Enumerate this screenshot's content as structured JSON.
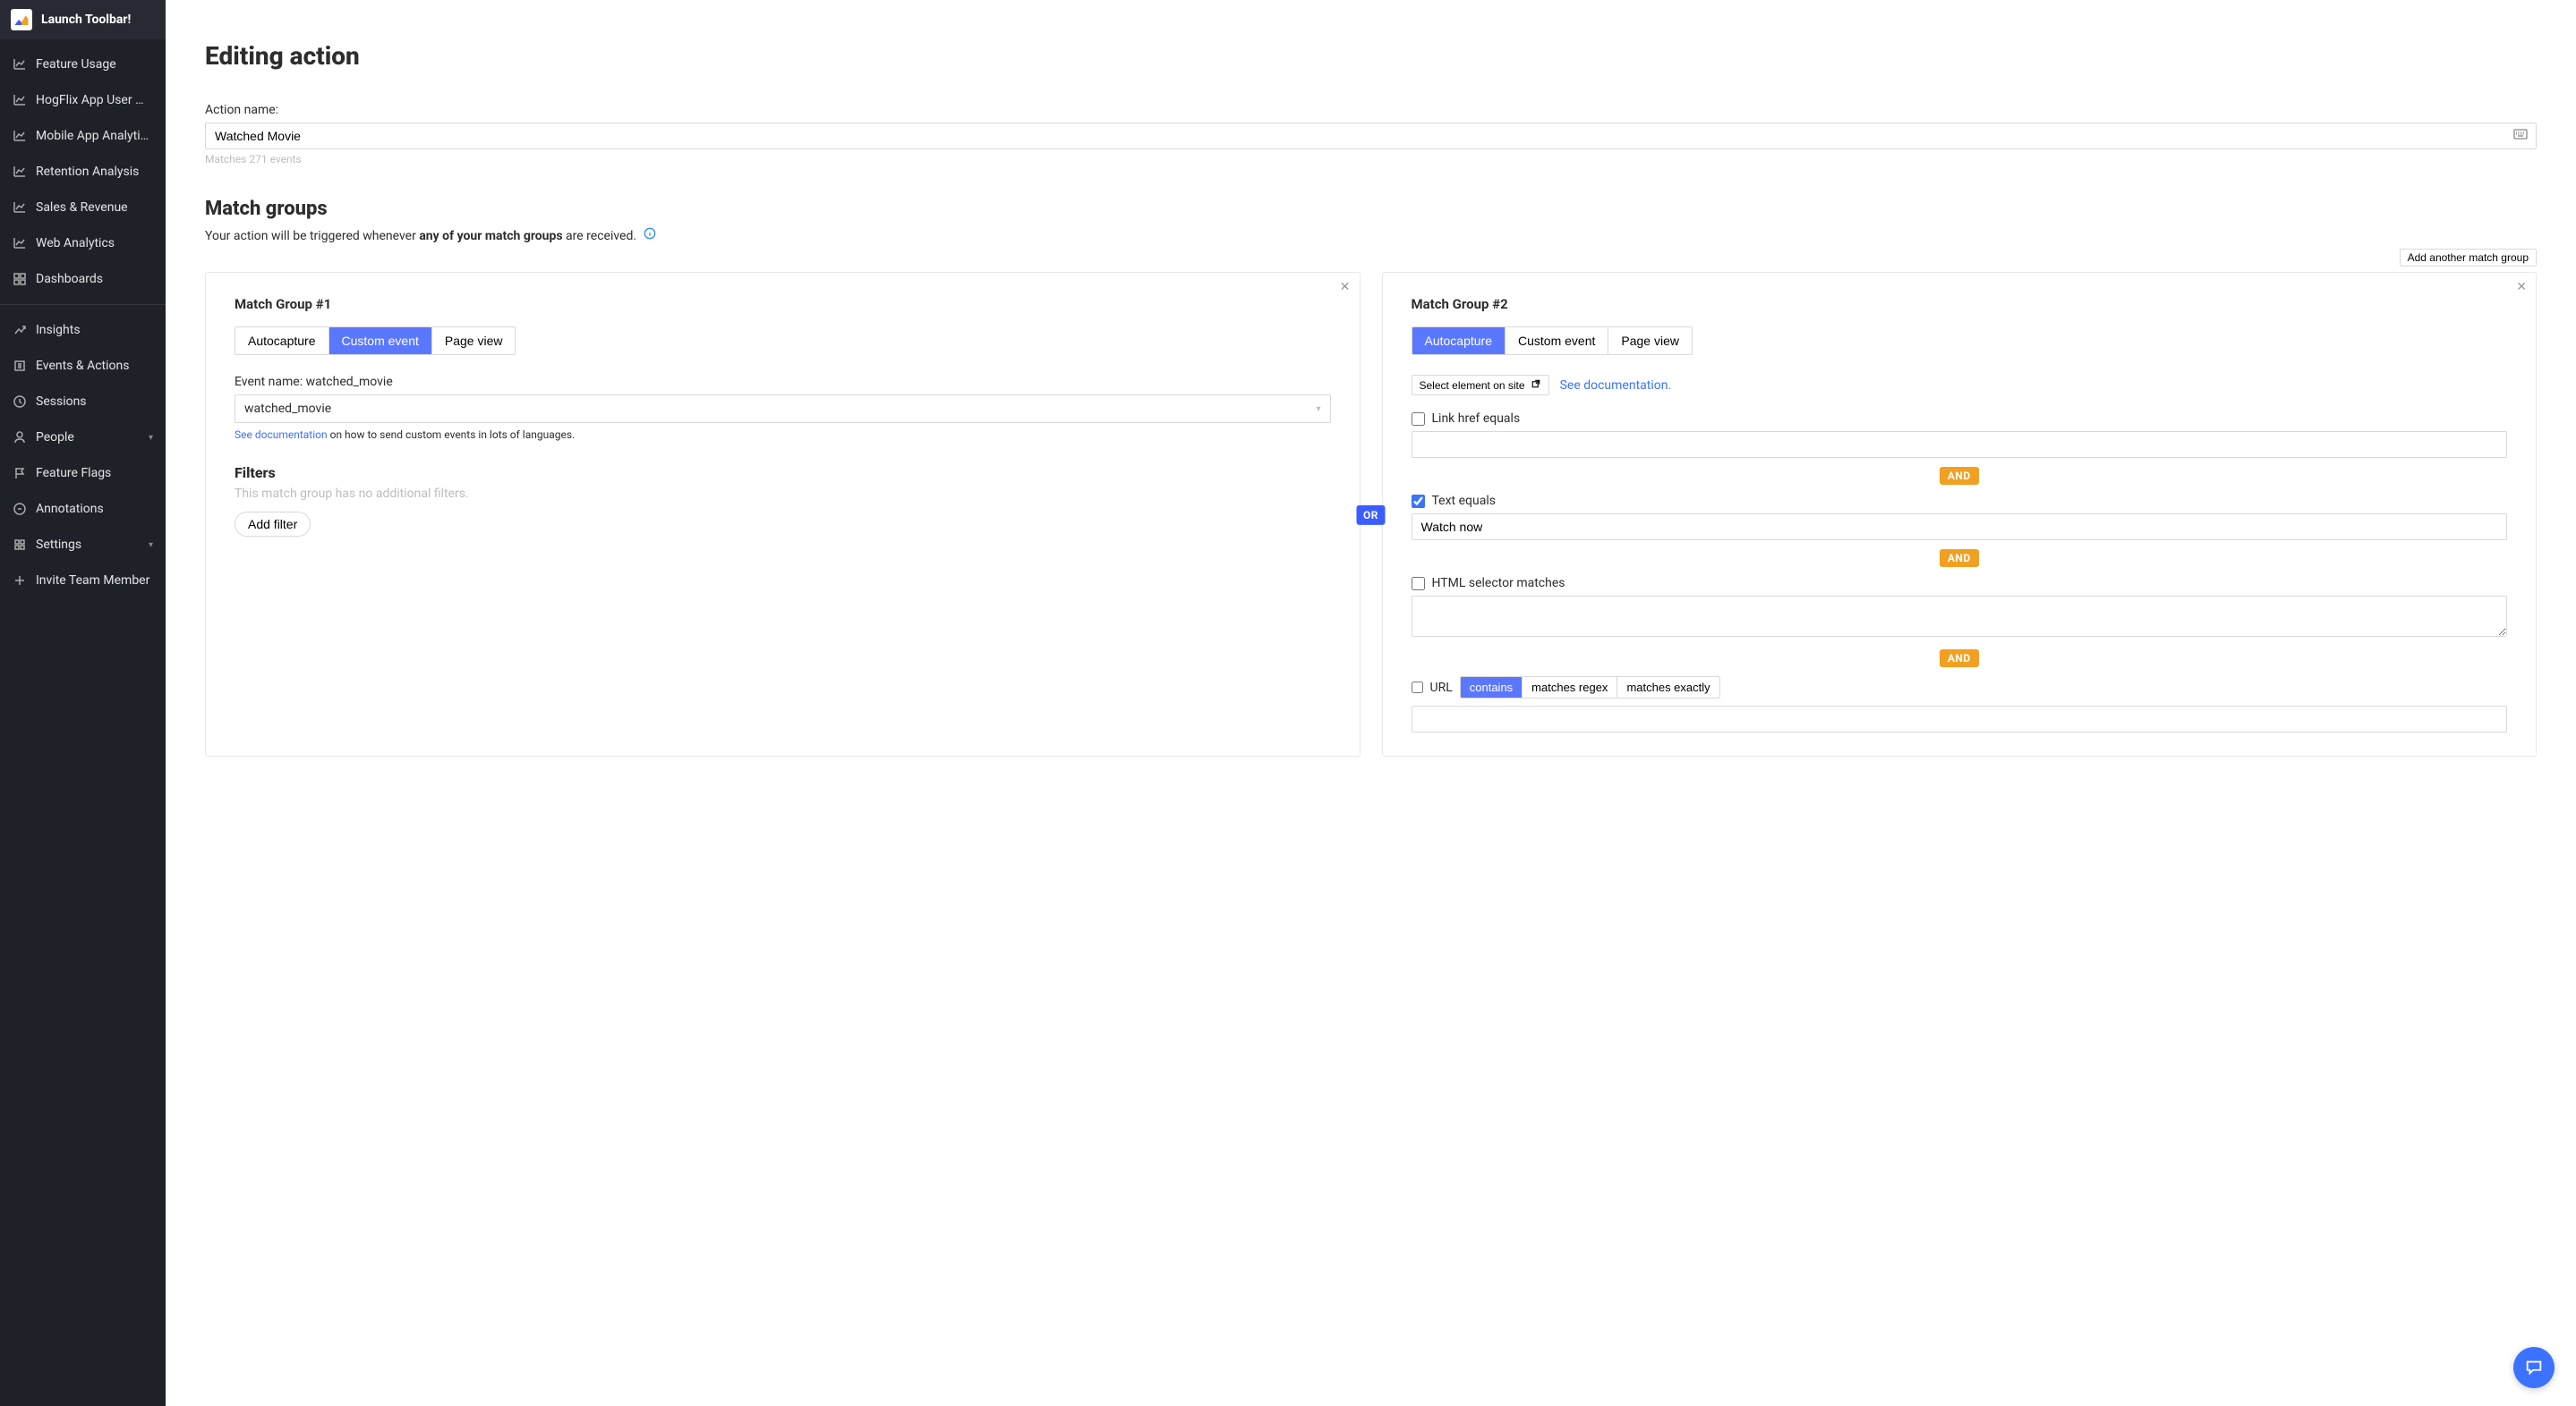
{
  "sidebar": {
    "launch": "Launch Toolbar!",
    "pinned": [
      {
        "label": "Feature Usage"
      },
      {
        "label": "HogFlix App User …"
      },
      {
        "label": "Mobile App Analyti…"
      },
      {
        "label": "Retention Analysis"
      },
      {
        "label": "Sales & Revenue"
      },
      {
        "label": "Web Analytics"
      },
      {
        "label": "Dashboards"
      }
    ],
    "nav": [
      {
        "label": "Insights",
        "icon": "insights"
      },
      {
        "label": "Events & Actions",
        "icon": "events"
      },
      {
        "label": "Sessions",
        "icon": "sessions"
      },
      {
        "label": "People",
        "icon": "people",
        "chevron": true
      },
      {
        "label": "Feature Flags",
        "icon": "flags"
      },
      {
        "label": "Annotations",
        "icon": "annotations"
      },
      {
        "label": "Settings",
        "icon": "settings",
        "chevron": true
      },
      {
        "label": "Invite Team Member",
        "icon": "plus"
      }
    ]
  },
  "page": {
    "title": "Editing action",
    "name_label": "Action name:",
    "name_value": "Watched Movie",
    "matches_hint": "Matches 271 events",
    "mg_heading": "Match groups",
    "mg_sub_prefix": "Your action will be triggered whenever ",
    "mg_sub_bold": "any of your match groups",
    "mg_sub_suffix": " are received.",
    "add_group_btn": "Add another match group",
    "or_badge": "OR",
    "and_badge": "AND"
  },
  "group1": {
    "title": "Match Group #1",
    "tabs": {
      "autocapture": "Autocapture",
      "custom": "Custom event",
      "pageview": "Page view"
    },
    "event_label_prefix": "Event name: ",
    "event_name": "watched_movie",
    "select_value": "watched_movie",
    "doc_link": "See documentation",
    "doc_suffix": " on how to send custom events in lots of languages.",
    "filters_h": "Filters",
    "no_filters": "This match group has no additional filters.",
    "add_filter": "Add filter"
  },
  "group2": {
    "title": "Match Group #2",
    "tabs": {
      "autocapture": "Autocapture",
      "custom": "Custom event",
      "pageview": "Page view"
    },
    "select_elem": "Select element on site",
    "see_docs": "See documentation.",
    "link_href_label": "Link href equals",
    "link_href_value": "",
    "text_equals_label": "Text equals",
    "text_equals_value": "Watch now",
    "selector_label": "HTML selector matches",
    "selector_value": "",
    "url_label": "URL",
    "url_opts": {
      "contains": "contains",
      "regex": "matches regex",
      "exact": "matches exactly"
    },
    "url_value": ""
  }
}
